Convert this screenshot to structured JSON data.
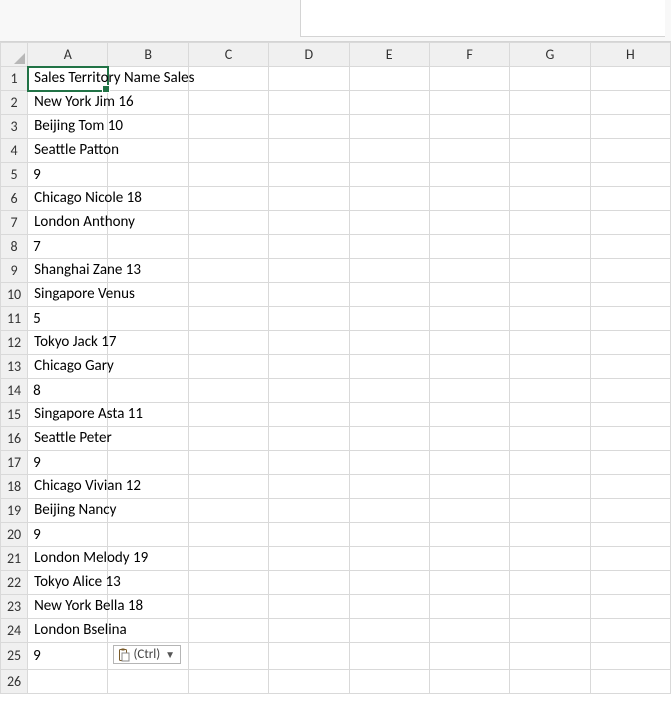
{
  "columns": [
    "A",
    "B",
    "C",
    "D",
    "E",
    "F",
    "G",
    "H"
  ],
  "row_count": 26,
  "active_cell": {
    "row": 1,
    "col": "A"
  },
  "paste_options": {
    "label": "(Ctrl)"
  },
  "cells": {
    "1": {
      "A": {
        "text": "Sales Territory Name Sales",
        "overflow": true
      }
    },
    "2": {
      "A": {
        "text": "New York Jim 16",
        "overflow": true
      }
    },
    "3": {
      "A": {
        "text": "Beijing Tom 10",
        "overflow": true
      }
    },
    "4": {
      "A": {
        "text": "Seattle Patton",
        "overflow": true
      }
    },
    "5": {
      "A": {
        "text": "9",
        "num": true
      }
    },
    "6": {
      "A": {
        "text": "Chicago Nicole 18",
        "overflow": true
      }
    },
    "7": {
      "A": {
        "text": "London Anthony",
        "overflow": true
      }
    },
    "8": {
      "A": {
        "text": "7",
        "num": true
      }
    },
    "9": {
      "A": {
        "text": "Shanghai Zane 13",
        "overflow": true
      }
    },
    "10": {
      "A": {
        "text": "Singapore Venus",
        "overflow": true
      }
    },
    "11": {
      "A": {
        "text": "5",
        "num": true
      }
    },
    "12": {
      "A": {
        "text": "Tokyo Jack 17",
        "overflow": true
      }
    },
    "13": {
      "A": {
        "text": "Chicago Gary",
        "overflow": true
      }
    },
    "14": {
      "A": {
        "text": "8",
        "num": true
      }
    },
    "15": {
      "A": {
        "text": "Singapore Asta 11",
        "overflow": true
      }
    },
    "16": {
      "A": {
        "text": "Seattle Peter",
        "overflow": true
      }
    },
    "17": {
      "A": {
        "text": "9",
        "num": true
      }
    },
    "18": {
      "A": {
        "text": "Chicago Vivian 12",
        "overflow": true
      }
    },
    "19": {
      "A": {
        "text": "Beijing Nancy",
        "overflow": true
      }
    },
    "20": {
      "A": {
        "text": "9",
        "num": true
      }
    },
    "21": {
      "A": {
        "text": "London Melody 19",
        "overflow": true
      }
    },
    "22": {
      "A": {
        "text": "Tokyo Alice 13",
        "overflow": true
      }
    },
    "23": {
      "A": {
        "text": "New York Bella 18",
        "overflow": true
      }
    },
    "24": {
      "A": {
        "text": "London Bselina",
        "overflow": true
      }
    },
    "25": {
      "A": {
        "text": "9",
        "num": true
      },
      "B": {
        "paste_options": true
      }
    }
  }
}
